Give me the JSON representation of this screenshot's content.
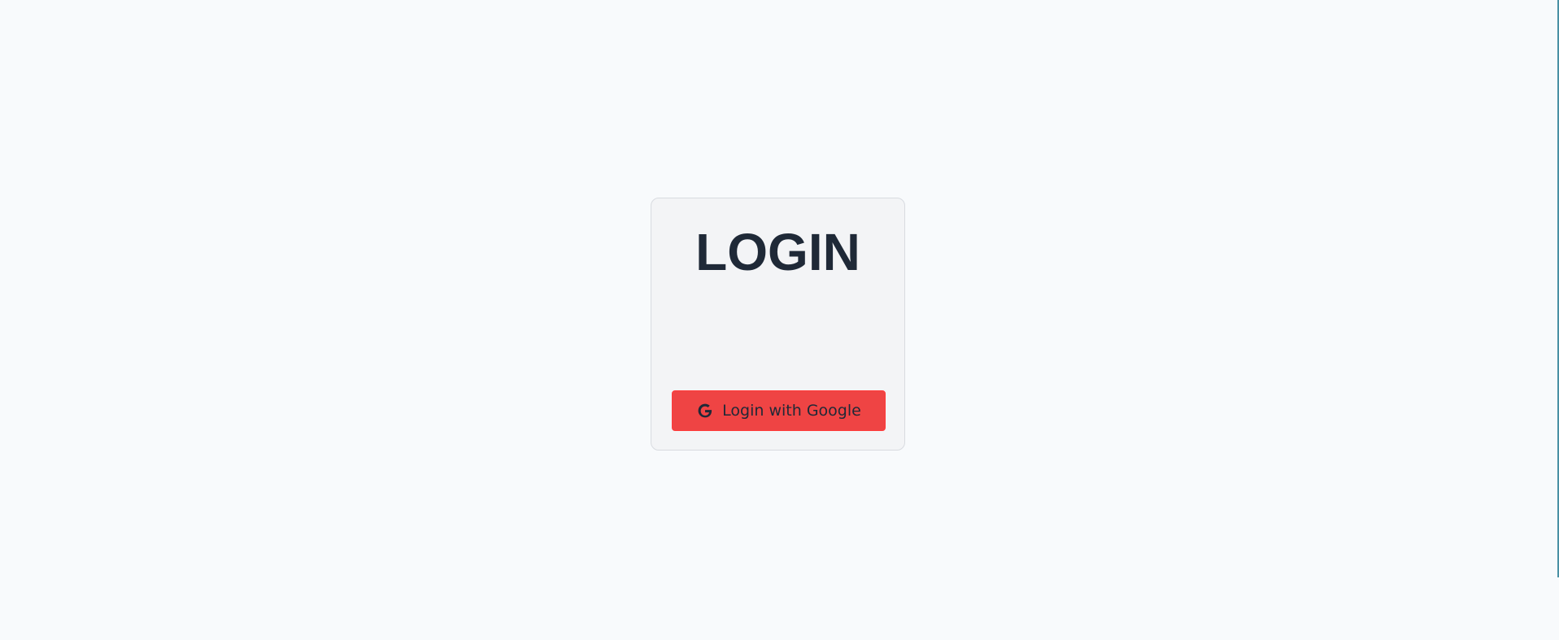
{
  "login": {
    "title": "LOGIN",
    "google_button_label": "Login with Google",
    "google_icon": "google-icon"
  },
  "colors": {
    "background": "#f8fafc",
    "card": "#f3f4f6",
    "button": "#ef4444",
    "text": "#1f2937"
  }
}
